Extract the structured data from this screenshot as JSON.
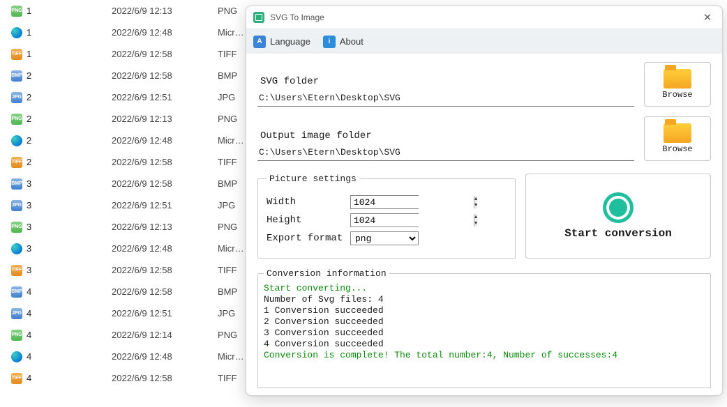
{
  "file_list": [
    {
      "name": "1",
      "date": "2022/6/9 12:13",
      "type": "PNG",
      "icon": "png"
    },
    {
      "name": "1",
      "date": "2022/6/9 12:48",
      "type": "Micr…",
      "icon": "edge"
    },
    {
      "name": "1",
      "date": "2022/6/9 12:58",
      "type": "TIFF",
      "icon": "tiff"
    },
    {
      "name": "2",
      "date": "2022/6/9 12:58",
      "type": "BMP",
      "icon": "bmp"
    },
    {
      "name": "2",
      "date": "2022/6/9 12:51",
      "type": "JPG",
      "icon": "jpg"
    },
    {
      "name": "2",
      "date": "2022/6/9 12:13",
      "type": "PNG",
      "icon": "png"
    },
    {
      "name": "2",
      "date": "2022/6/9 12:48",
      "type": "Micr…",
      "icon": "edge"
    },
    {
      "name": "2",
      "date": "2022/6/9 12:58",
      "type": "TIFF",
      "icon": "tiff"
    },
    {
      "name": "3",
      "date": "2022/6/9 12:58",
      "type": "BMP",
      "icon": "bmp"
    },
    {
      "name": "3",
      "date": "2022/6/9 12:51",
      "type": "JPG",
      "icon": "jpg"
    },
    {
      "name": "3",
      "date": "2022/6/9 12:13",
      "type": "PNG",
      "icon": "png"
    },
    {
      "name": "3",
      "date": "2022/6/9 12:48",
      "type": "Micr…",
      "icon": "edge"
    },
    {
      "name": "3",
      "date": "2022/6/9 12:58",
      "type": "TIFF",
      "icon": "tiff"
    },
    {
      "name": "4",
      "date": "2022/6/9 12:58",
      "type": "BMP",
      "icon": "bmp"
    },
    {
      "name": "4",
      "date": "2022/6/9 12:51",
      "type": "JPG",
      "icon": "jpg"
    },
    {
      "name": "4",
      "date": "2022/6/9 12:14",
      "type": "PNG",
      "icon": "png"
    },
    {
      "name": "4",
      "date": "2022/6/9 12:48",
      "type": "Micr…",
      "icon": "edge"
    },
    {
      "name": "4",
      "date": "2022/6/9 12:58",
      "type": "TIFF",
      "icon": "tiff"
    }
  ],
  "dialog": {
    "title": "SVG To Image",
    "menubar": {
      "language": "Language",
      "about": "About"
    },
    "svg_folder": {
      "label": "SVG folder",
      "path": "C:\\Users\\Etern\\Desktop\\SVG",
      "browse": "Browse"
    },
    "output_folder": {
      "label": "Output image folder",
      "path": "C:\\Users\\Etern\\Desktop\\SVG",
      "browse": "Browse"
    },
    "settings": {
      "legend": "Picture settings",
      "width_label": "Width",
      "width_value": "1024",
      "height_label": "Height",
      "height_value": "1024",
      "format_label": "Export format",
      "format_value": "png"
    },
    "start_button": "Start conversion",
    "info": {
      "legend": "Conversion information",
      "lines": [
        {
          "text": "Start converting...",
          "color": "green"
        },
        {
          "text": "Number of Svg files: 4",
          "color": ""
        },
        {
          "text": "1 Conversion succeeded",
          "color": ""
        },
        {
          "text": "2 Conversion succeeded",
          "color": ""
        },
        {
          "text": "3 Conversion succeeded",
          "color": ""
        },
        {
          "text": "4 Conversion succeeded",
          "color": ""
        },
        {
          "text": "Conversion is complete! The total number:4, Number of successes:4",
          "color": "green"
        }
      ]
    }
  },
  "icon_labels": {
    "png": "PNG",
    "tiff": "TIFF",
    "bmp": "BMP",
    "jpg": "JPG",
    "edge": ""
  }
}
